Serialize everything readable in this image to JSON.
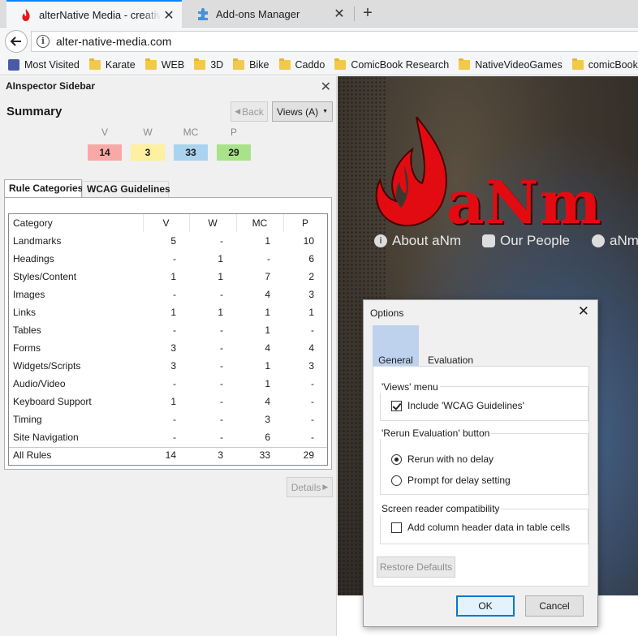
{
  "browser": {
    "tabs": [
      {
        "title": "alterNative Media - creativit",
        "active": true
      },
      {
        "title": "Add-ons Manager",
        "active": false
      }
    ],
    "url": "alter-native-media.com",
    "bookmarks": [
      "Most Visited",
      "Karate",
      "WEB",
      "3D",
      "Bike",
      "Caddo",
      "ComicBook Research",
      "NativeVideoGames",
      "comicBookcreation"
    ]
  },
  "sidebar": {
    "title": "AInspector Sidebar",
    "summary_title": "Summary",
    "back_label": "Back",
    "views_label": "Views (A)",
    "summary": [
      {
        "label": "V",
        "value": "14",
        "color": "#f9a8a8"
      },
      {
        "label": "W",
        "value": "3",
        "color": "#fdf0a0"
      },
      {
        "label": "MC",
        "value": "33",
        "color": "#a9d3ee"
      },
      {
        "label": "P",
        "value": "29",
        "color": "#a8e38a"
      }
    ],
    "tabs": [
      "Rule Categories",
      "WCAG Guidelines"
    ],
    "table": {
      "headers": [
        "Category",
        "V",
        "W",
        "MC",
        "P"
      ],
      "rows": [
        [
          "Landmarks",
          "5",
          "-",
          "1",
          "10"
        ],
        [
          "Headings",
          "-",
          "1",
          "-",
          "6"
        ],
        [
          "Styles/Content",
          "1",
          "1",
          "7",
          "2"
        ],
        [
          "Images",
          "-",
          "-",
          "4",
          "3"
        ],
        [
          "Links",
          "1",
          "1",
          "1",
          "1"
        ],
        [
          "Tables",
          "-",
          "-",
          "1",
          "-"
        ],
        [
          "Forms",
          "3",
          "-",
          "4",
          "4"
        ],
        [
          "Widgets/Scripts",
          "3",
          "-",
          "1",
          "3"
        ],
        [
          "Audio/Video",
          "-",
          "-",
          "1",
          "-"
        ],
        [
          "Keyboard Support",
          "1",
          "-",
          "4",
          "-"
        ],
        [
          "Timing",
          "-",
          "-",
          "3",
          "-"
        ],
        [
          "Site Navigation",
          "-",
          "-",
          "6",
          "-"
        ]
      ],
      "total": [
        "All Rules",
        "14",
        "3",
        "33",
        "29"
      ]
    },
    "details_label": "Details"
  },
  "page": {
    "logo_text": "aNm",
    "nav": [
      "About aNm",
      "Our People",
      "aNm"
    ]
  },
  "dialog": {
    "title": "Options",
    "tabs": [
      "General",
      "Evaluation"
    ],
    "groups": {
      "views_menu": {
        "label": "'Views' menu",
        "include_wcag": "Include 'WCAG Guidelines'"
      },
      "rerun": {
        "label": "'Rerun Evaluation' button",
        "no_delay": "Rerun with no delay",
        "prompt": "Prompt for delay setting"
      },
      "screen_reader": {
        "label": "Screen reader compatibility",
        "add_header": "Add column header data in table cells"
      }
    },
    "restore_label": "Restore Defaults",
    "ok_label": "OK",
    "cancel_label": "Cancel"
  }
}
